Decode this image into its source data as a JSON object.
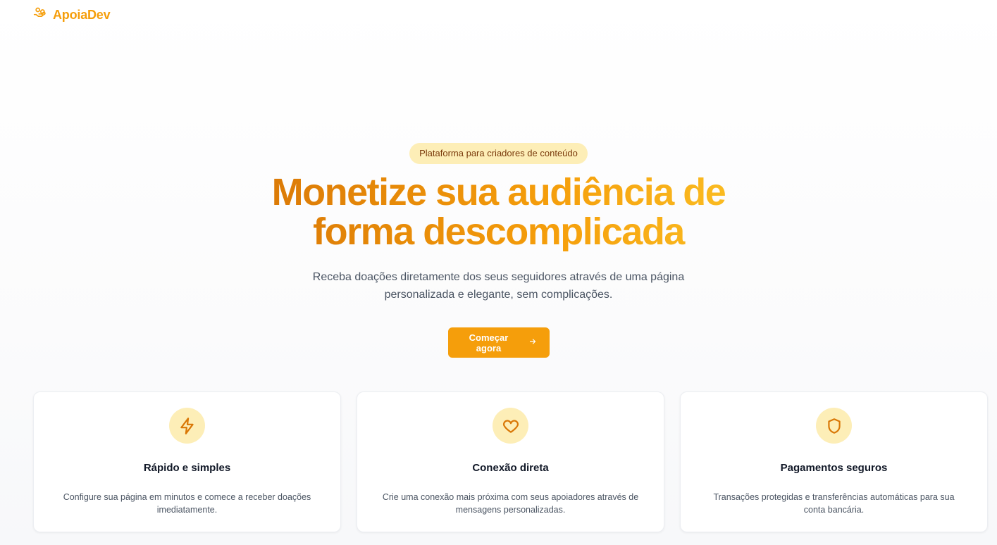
{
  "brand": {
    "name": "ApoiaDev",
    "icon": "hand-coins-icon",
    "color": "#f59e0b"
  },
  "hero": {
    "badge": "Plataforma para criadores de conteúdo",
    "headline": "Monetize sua audiência de forma descomplicada",
    "subtitle": "Receba doações diretamente dos seus seguidores através de uma página personalizada e elegante, sem complicações.",
    "cta_label": "Começar agora",
    "cta_icon": "arrow-right-icon"
  },
  "features": [
    {
      "icon": "lightning-icon",
      "title": "Rápido e simples",
      "text": "Configure sua página em minutos e comece a receber doações imediatamente."
    },
    {
      "icon": "heart-icon",
      "title": "Conexão direta",
      "text": "Crie uma conexão mais próxima com seus apoiadores através de mensagens personalizadas."
    },
    {
      "icon": "shield-icon",
      "title": "Pagamentos seguros",
      "text": "Transações protegidas e transferências automáticas para sua conta bancária."
    }
  ],
  "colors": {
    "accent": "#f59e0b",
    "accent_dark": "#d97706",
    "badge_bg": "#fdeeb7",
    "badge_text": "#7a3a0b"
  }
}
